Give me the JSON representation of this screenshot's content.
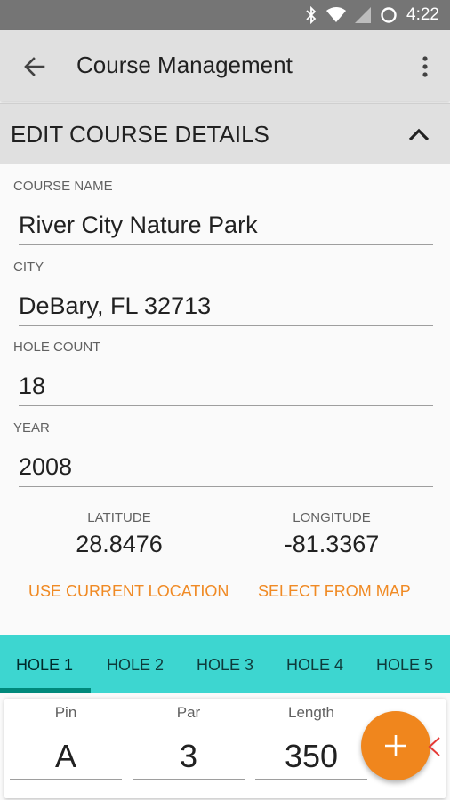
{
  "status_bar": {
    "time": "4:22",
    "icons": [
      "bluetooth-icon",
      "wifi-icon",
      "signal-icon",
      "alarm-icon"
    ]
  },
  "app_bar": {
    "title": "Course Management",
    "back_icon": "arrow-back-icon",
    "menu_icon": "more-vert-icon"
  },
  "section": {
    "title": "EDIT COURSE DETAILS",
    "toggle_icon": "chevron-up-icon"
  },
  "form": {
    "course_name": {
      "label": "COURSE NAME",
      "value": "River City Nature Park"
    },
    "city": {
      "label": "CITY",
      "value": "DeBary, FL 32713"
    },
    "hole_count": {
      "label": "HOLE COUNT",
      "value": "18"
    },
    "year": {
      "label": "YEAR",
      "value": "2008"
    }
  },
  "location": {
    "latitude_label": "LATITUDE",
    "latitude": "28.8476",
    "longitude_label": "LONGITUDE",
    "longitude": "-81.3367",
    "use_current": "USE CURRENT LOCATION",
    "select_map": "SELECT FROM MAP"
  },
  "tabs": [
    {
      "label": "HOLE 1",
      "selected": true
    },
    {
      "label": "HOLE 2",
      "selected": false
    },
    {
      "label": "HOLE 3",
      "selected": false
    },
    {
      "label": "HOLE 4",
      "selected": false
    },
    {
      "label": "HOLE 5",
      "selected": false
    }
  ],
  "hole": {
    "pin_label": "Pin",
    "pin": "A",
    "par_label": "Par",
    "par": "3",
    "length_label": "Length",
    "length": "350"
  },
  "fab_icon": "add-icon",
  "colors": {
    "accent": "#f0861d",
    "tabbar": "#3dd6d0",
    "tab_indicator": "#00897b",
    "appbar": "#e0e0e0"
  }
}
